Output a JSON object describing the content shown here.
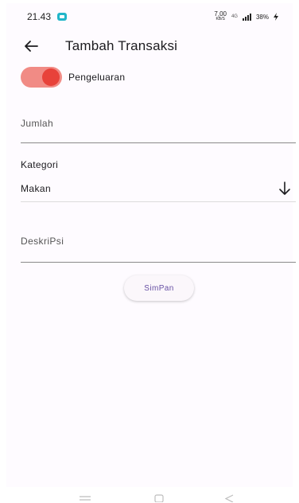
{
  "status_bar": {
    "time": "21.43",
    "speed_value": "7,00",
    "speed_unit": "KB/S",
    "network": "4G",
    "battery": "38%"
  },
  "app_bar": {
    "title": "Tambah Transaksi",
    "back_icon": "arrow-left-icon"
  },
  "type_switch": {
    "label": "Pengeluaran",
    "on": true,
    "track_color": "#f18b85",
    "thumb_color": "#e8423a"
  },
  "form": {
    "amount": {
      "placeholder": "Jumlah",
      "value": ""
    },
    "category": {
      "label": "Kategori",
      "selected": "Makan",
      "icon": "arrow-down-icon"
    },
    "description": {
      "placeholder": "DeskriPsi",
      "value": ""
    },
    "save_label": "SimPan"
  },
  "colors": {
    "accent": "#6750a4",
    "background": "#fefbff"
  },
  "nav_bar": {
    "icons": [
      "menu-icon",
      "home-icon",
      "back-icon"
    ]
  }
}
